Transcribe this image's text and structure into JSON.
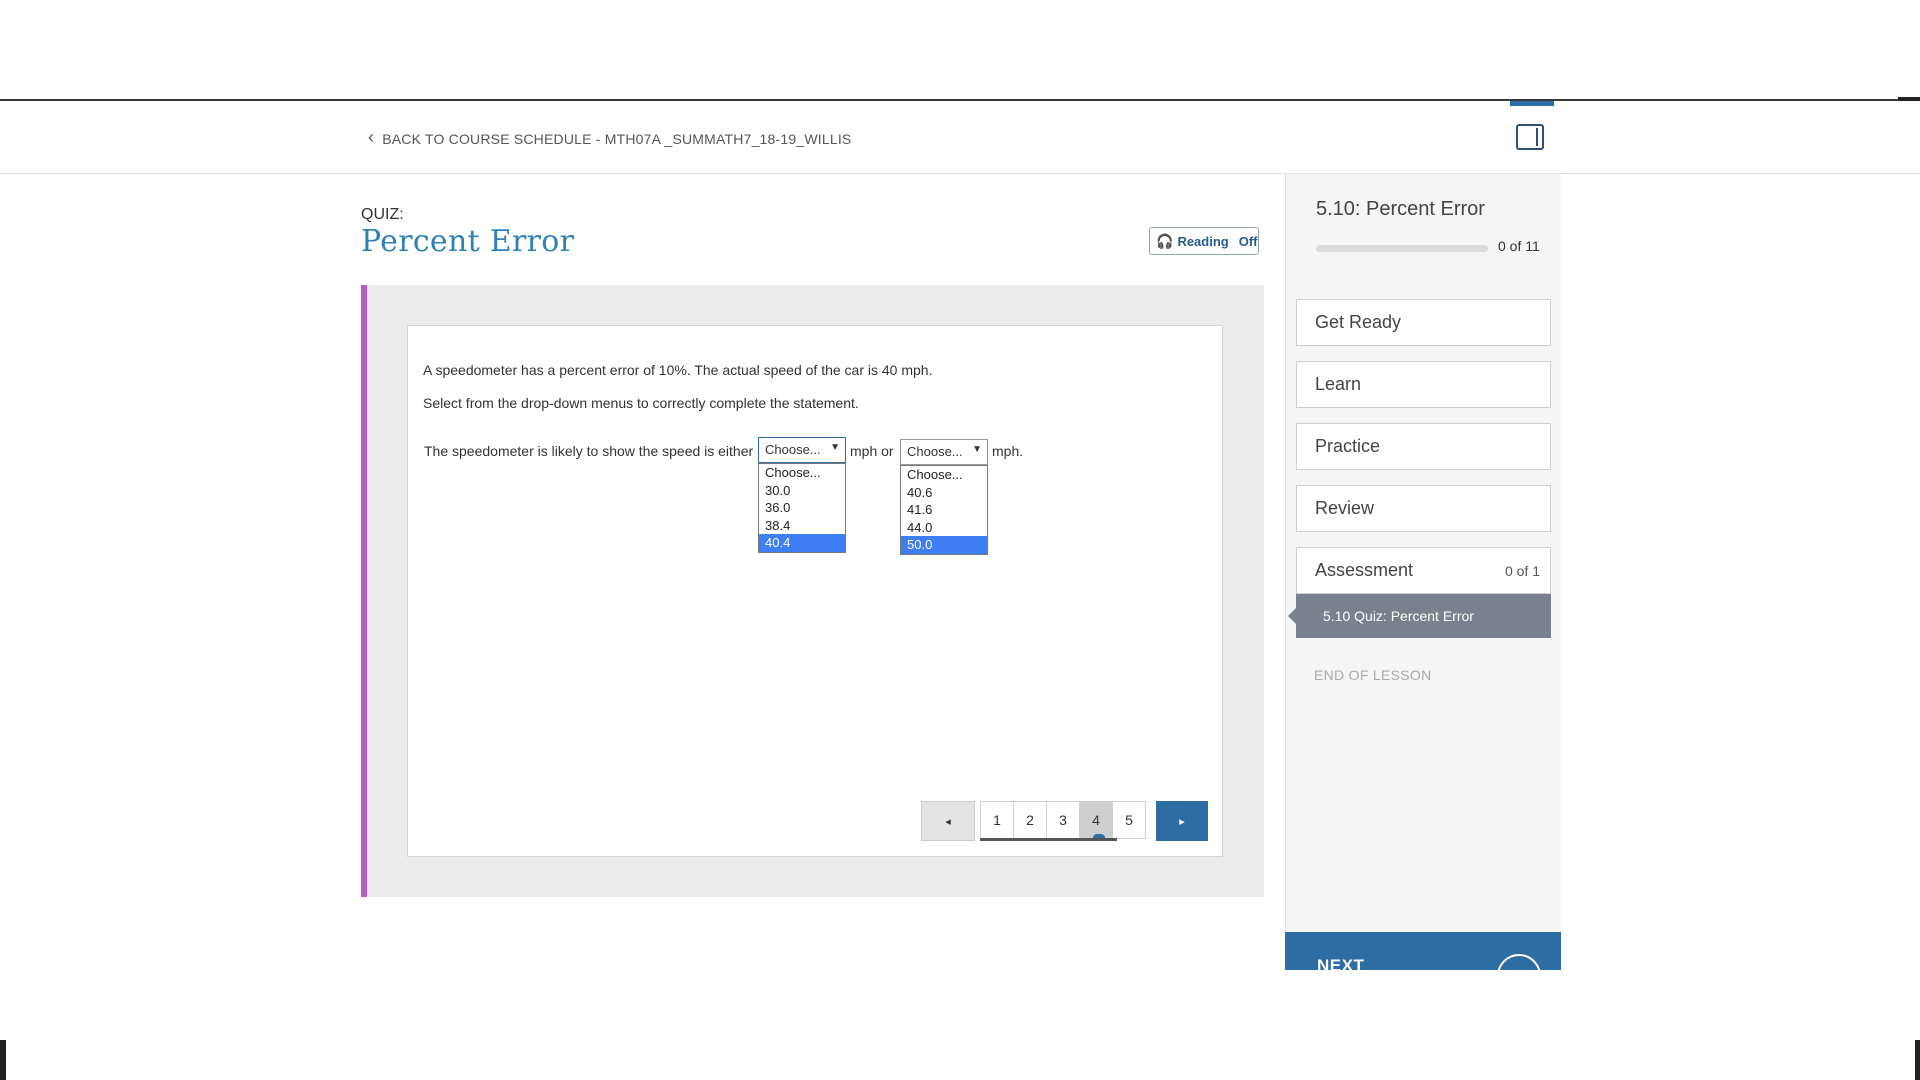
{
  "header": {
    "back_link": "BACK TO COURSE SCHEDULE - MTH07A _SUMMATH7_18-19_WILLIS",
    "back_icon": "chevron-left-icon",
    "panel_toggle_icon": "panel-toggle-icon"
  },
  "quiz": {
    "label": "QUIZ:",
    "title": "Percent Error",
    "reading": {
      "label": "Reading",
      "state": "Off",
      "icon": "headphones-icon"
    }
  },
  "question": {
    "prompt": "A speedometer has a percent error of 10%. The actual speed of the car is 40 mph.",
    "instruction": "Select from the drop-down menus to correctly complete the statement.",
    "statement_start": "The speedometer is likely to show the speed is either",
    "statement_mid": "mph or",
    "statement_end": "mph.",
    "dropdown1": {
      "value": "Choose...",
      "options": [
        "Choose...",
        "30.0",
        "36.0",
        "38.4",
        "40.4"
      ],
      "highlighted": "40.4"
    },
    "dropdown2": {
      "value": "Choose...",
      "options": [
        "Choose...",
        "40.6",
        "41.6",
        "44.0",
        "50.0"
      ],
      "highlighted": "50.0"
    }
  },
  "pagination": {
    "prev_symbol": "◂",
    "next_symbol": "▸",
    "pages": [
      "1",
      "2",
      "3",
      "4",
      "5"
    ],
    "current": "4"
  },
  "sidebar": {
    "lesson_title": "5.10: Percent Error",
    "progress": {
      "completed": 0,
      "total": 11,
      "text": "0 of 11"
    },
    "items": [
      {
        "label": "Get Ready"
      },
      {
        "label": "Learn"
      },
      {
        "label": "Practice"
      },
      {
        "label": "Review"
      },
      {
        "label": "Assessment",
        "count": "0 of 1"
      }
    ],
    "active_sub_item": "5.10 Quiz: Percent Error",
    "end_label": "END OF LESSON",
    "next_button": "NEXT"
  },
  "colors": {
    "accent": "#2e6da4",
    "title_blue": "#2f80b5",
    "stage_border": "#b25fc9",
    "dropdown_highlight": "#3d7ef5"
  }
}
